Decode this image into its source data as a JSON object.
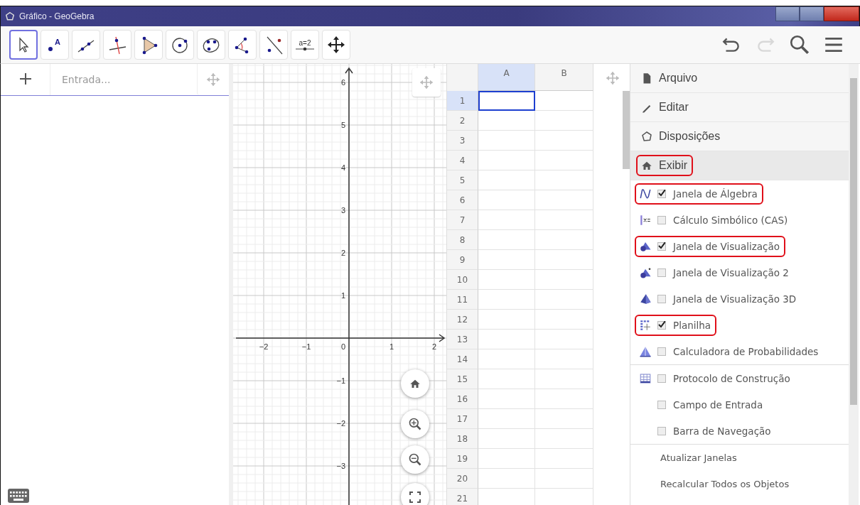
{
  "window": {
    "title": "Gráfico - GeoGebra"
  },
  "toolbar": {
    "tools": [
      {
        "kind": "move",
        "selected": true
      },
      {
        "kind": "point",
        "selected": false,
        "label": "A"
      },
      {
        "kind": "line",
        "selected": false
      },
      {
        "kind": "perpendicular",
        "selected": false
      },
      {
        "kind": "polygon",
        "selected": false
      },
      {
        "kind": "circle",
        "selected": false
      },
      {
        "kind": "conic",
        "selected": false
      },
      {
        "kind": "angle",
        "selected": false
      },
      {
        "kind": "reflect",
        "selected": false
      },
      {
        "kind": "slider",
        "selected": false,
        "label": "a=2"
      },
      {
        "kind": "transform",
        "selected": false
      }
    ],
    "actions": [
      {
        "kind": "undo",
        "disabled": false
      },
      {
        "kind": "redo",
        "disabled": true
      },
      {
        "kind": "search",
        "disabled": false
      },
      {
        "kind": "menu",
        "disabled": false
      }
    ]
  },
  "algebra": {
    "input": {
      "placeholder": "Entrada..."
    }
  },
  "graphics": {
    "x_ticks": [
      "−2",
      "−1",
      "0",
      "1",
      "2"
    ],
    "y_ticks": [
      "6",
      "5",
      "4",
      "3",
      "2",
      "1",
      "−1",
      "−2",
      "−3"
    ]
  },
  "spreadsheet": {
    "columns": [
      {
        "label": "A",
        "selected": true
      },
      {
        "label": "B",
        "selected": false
      }
    ],
    "rows": [
      {
        "label": "1",
        "selected": true
      },
      {
        "label": "2",
        "selected": false
      },
      {
        "label": "3",
        "selected": false
      },
      {
        "label": "4",
        "selected": false
      },
      {
        "label": "5",
        "selected": false
      },
      {
        "label": "6",
        "selected": false
      },
      {
        "label": "7",
        "selected": false
      },
      {
        "label": "8",
        "selected": false
      },
      {
        "label": "9",
        "selected": false
      },
      {
        "label": "10",
        "selected": false
      },
      {
        "label": "11",
        "selected": false
      },
      {
        "label": "12",
        "selected": false
      },
      {
        "label": "13",
        "selected": false
      },
      {
        "label": "14",
        "selected": false
      },
      {
        "label": "15",
        "selected": false
      },
      {
        "label": "16",
        "selected": false
      },
      {
        "label": "17",
        "selected": false
      },
      {
        "label": "18",
        "selected": false
      },
      {
        "label": "19",
        "selected": false
      },
      {
        "label": "20",
        "selected": false
      },
      {
        "label": "21",
        "selected": false
      }
    ]
  },
  "menu": {
    "main": [
      {
        "label": "Arquivo",
        "selected": false,
        "highlighted": false
      },
      {
        "label": "Editar",
        "selected": false,
        "highlighted": false
      },
      {
        "label": "Disposições",
        "selected": false,
        "highlighted": false
      },
      {
        "label": "Exibir",
        "selected": true,
        "highlighted": true
      }
    ],
    "views": [
      {
        "label": "Janela de Álgebra",
        "checked": true,
        "highlighted": true
      },
      {
        "label": "Cálculo Simbólico (CAS)",
        "checked": false,
        "highlighted": false
      },
      {
        "label": "Janela de Visualização",
        "checked": true,
        "highlighted": true
      },
      {
        "label": "Janela de Visualização 2",
        "checked": false,
        "highlighted": false
      },
      {
        "label": "Janela de Visualização 3D",
        "checked": false,
        "highlighted": false
      },
      {
        "label": "Planilha",
        "checked": true,
        "highlighted": true
      },
      {
        "label": "Calculadora de Probabilidades",
        "checked": false,
        "highlighted": false
      }
    ],
    "panels": [
      {
        "label": "Protocolo de Construção",
        "checked": false
      },
      {
        "label": "Campo de Entrada",
        "checked": false
      },
      {
        "label": "Barra de Navegação",
        "checked": false
      }
    ],
    "actions": [
      {
        "label": "Atualizar Janelas"
      },
      {
        "label": "Recalcular Todos os Objetos"
      }
    ]
  }
}
